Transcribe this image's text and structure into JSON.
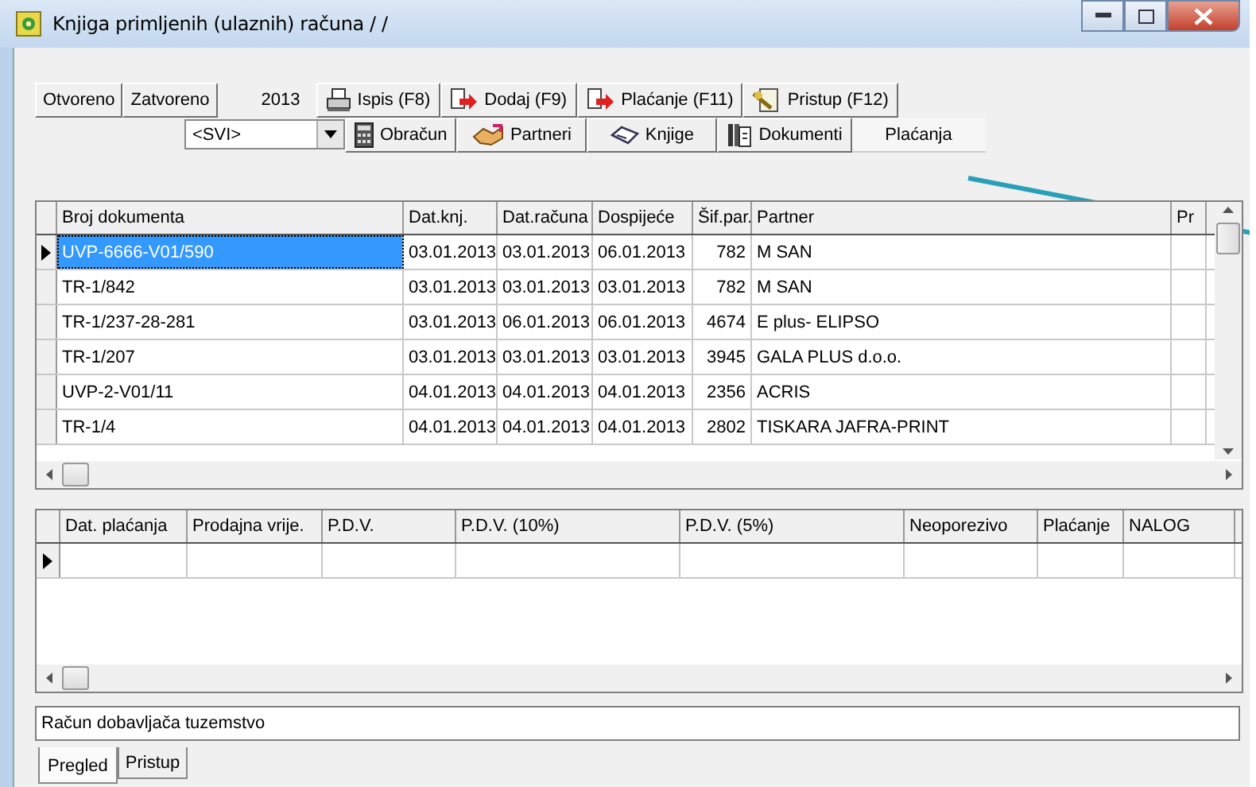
{
  "window": {
    "title": "Knjiga primljenih (ulaznih) računa / /"
  },
  "filters": [
    {
      "label": "Otvoreno",
      "selected": false
    },
    {
      "label": "Zatvoreno",
      "selected": false
    }
  ],
  "year": "2013",
  "dropdown": {
    "value": "<SVI>"
  },
  "toolbar_row1": [
    {
      "label": "Ispis (F8)",
      "kind": "printer"
    },
    {
      "label": "Dodaj (F9)",
      "kind": "add"
    },
    {
      "label": "Plaćanje (F11)",
      "kind": "add"
    },
    {
      "label": "Pristup (F12)",
      "kind": "access"
    }
  ],
  "toolbar_row2": [
    {
      "label": "Obračun",
      "kind": "calculator"
    },
    {
      "label": "Partneri",
      "kind": "handshake"
    },
    {
      "label": "Knjige",
      "kind": "book"
    },
    {
      "label": "Dokumenti",
      "kind": "docs"
    }
  ],
  "plain_tab": "Plaćanja",
  "table": {
    "columns": [
      "Broj dokumenta",
      "Dat.knj.",
      "Dat.računa",
      "Dospijeće",
      "Šif.par.",
      "Partner",
      "Pr"
    ],
    "rows": [
      {
        "selected": true,
        "cells": [
          "UVP-6666-V01/590",
          "03.01.2013",
          "03.01.2013",
          "06.01.2013",
          "782",
          "M SAN"
        ]
      },
      {
        "selected": false,
        "cells": [
          "TR-1/842",
          "03.01.2013",
          "03.01.2013",
          "03.01.2013",
          "782",
          "M SAN"
        ]
      },
      {
        "selected": false,
        "cells": [
          "TR-1/237-28-281",
          "03.01.2013",
          "06.01.2013",
          "06.01.2013",
          "4674",
          "E plus- ELIPSO"
        ]
      },
      {
        "selected": false,
        "cells": [
          "TR-1/207",
          "03.01.2013",
          "03.01.2013",
          "03.01.2013",
          "3945",
          "GALA PLUS d.o.o."
        ]
      },
      {
        "selected": false,
        "cells": [
          "UVP-2-V01/11",
          "04.01.2013",
          "04.01.2013",
          "04.01.2013",
          "2356",
          "ACRIS"
        ]
      },
      {
        "selected": false,
        "cells": [
          "TR-1/4",
          "04.01.2013",
          "04.01.2013",
          "04.01.2013",
          "2802",
          "TISKARA JAFRA-PRINT"
        ]
      }
    ]
  },
  "payments": {
    "columns": [
      "Dat. plaćanja",
      "Prodajna vrije.",
      "P.D.V.",
      "P.D.V. (10%)",
      "P.D.V. (5%)",
      "Neoporezivo",
      "Plaćanje",
      "NALOG"
    ]
  },
  "status": "Račun dobavljača tuzemstvo",
  "tabs": [
    {
      "label": "Pregled",
      "selected": true
    },
    {
      "label": "Pristup",
      "selected": false
    }
  ]
}
